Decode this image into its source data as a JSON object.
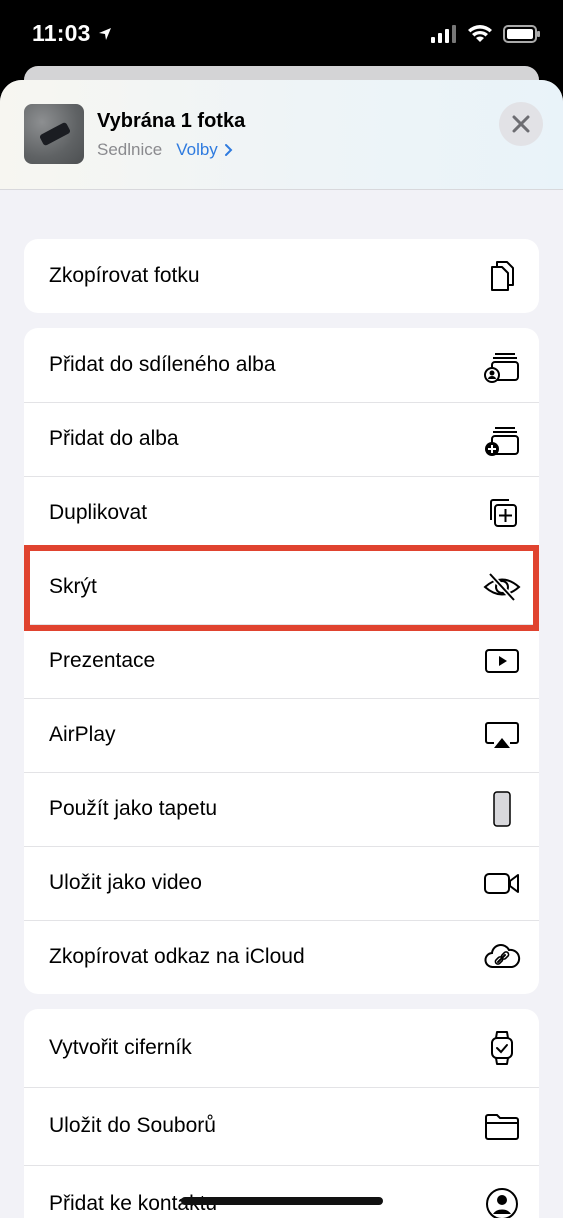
{
  "status_bar": {
    "time": "11:03"
  },
  "header": {
    "title": "Vybrána 1 fotka",
    "location": "Sedlnice",
    "options_label": "Volby"
  },
  "actions": {
    "group1": [
      {
        "label": "Zkopírovat fotku",
        "icon": "copy-icon"
      }
    ],
    "group2": [
      {
        "label": "Přidat do sdíleného alba",
        "icon": "shared-album-icon"
      },
      {
        "label": "Přidat do alba",
        "icon": "add-album-icon"
      },
      {
        "label": "Duplikovat",
        "icon": "duplicate-icon"
      },
      {
        "label": "Skrýt",
        "icon": "hide-eye-slash-icon",
        "highlighted": true
      },
      {
        "label": "Prezentace",
        "icon": "slideshow-play-icon"
      },
      {
        "label": "AirPlay",
        "icon": "airplay-icon"
      },
      {
        "label": "Použít jako tapetu",
        "icon": "phone-wallpaper-icon"
      },
      {
        "label": "Uložit jako video",
        "icon": "video-camera-icon"
      },
      {
        "label": "Zkopírovat odkaz na iCloud",
        "icon": "icloud-link-icon"
      }
    ],
    "group3": [
      {
        "label": "Vytvořit ciferník",
        "icon": "watch-icon"
      },
      {
        "label": "Uložit do Souborů",
        "icon": "folder-icon"
      },
      {
        "label": "Přidat ke kontaktu",
        "icon": "contact-icon"
      }
    ]
  },
  "colors": {
    "accent": "#2f7bdf",
    "highlight": "#e0432f"
  }
}
